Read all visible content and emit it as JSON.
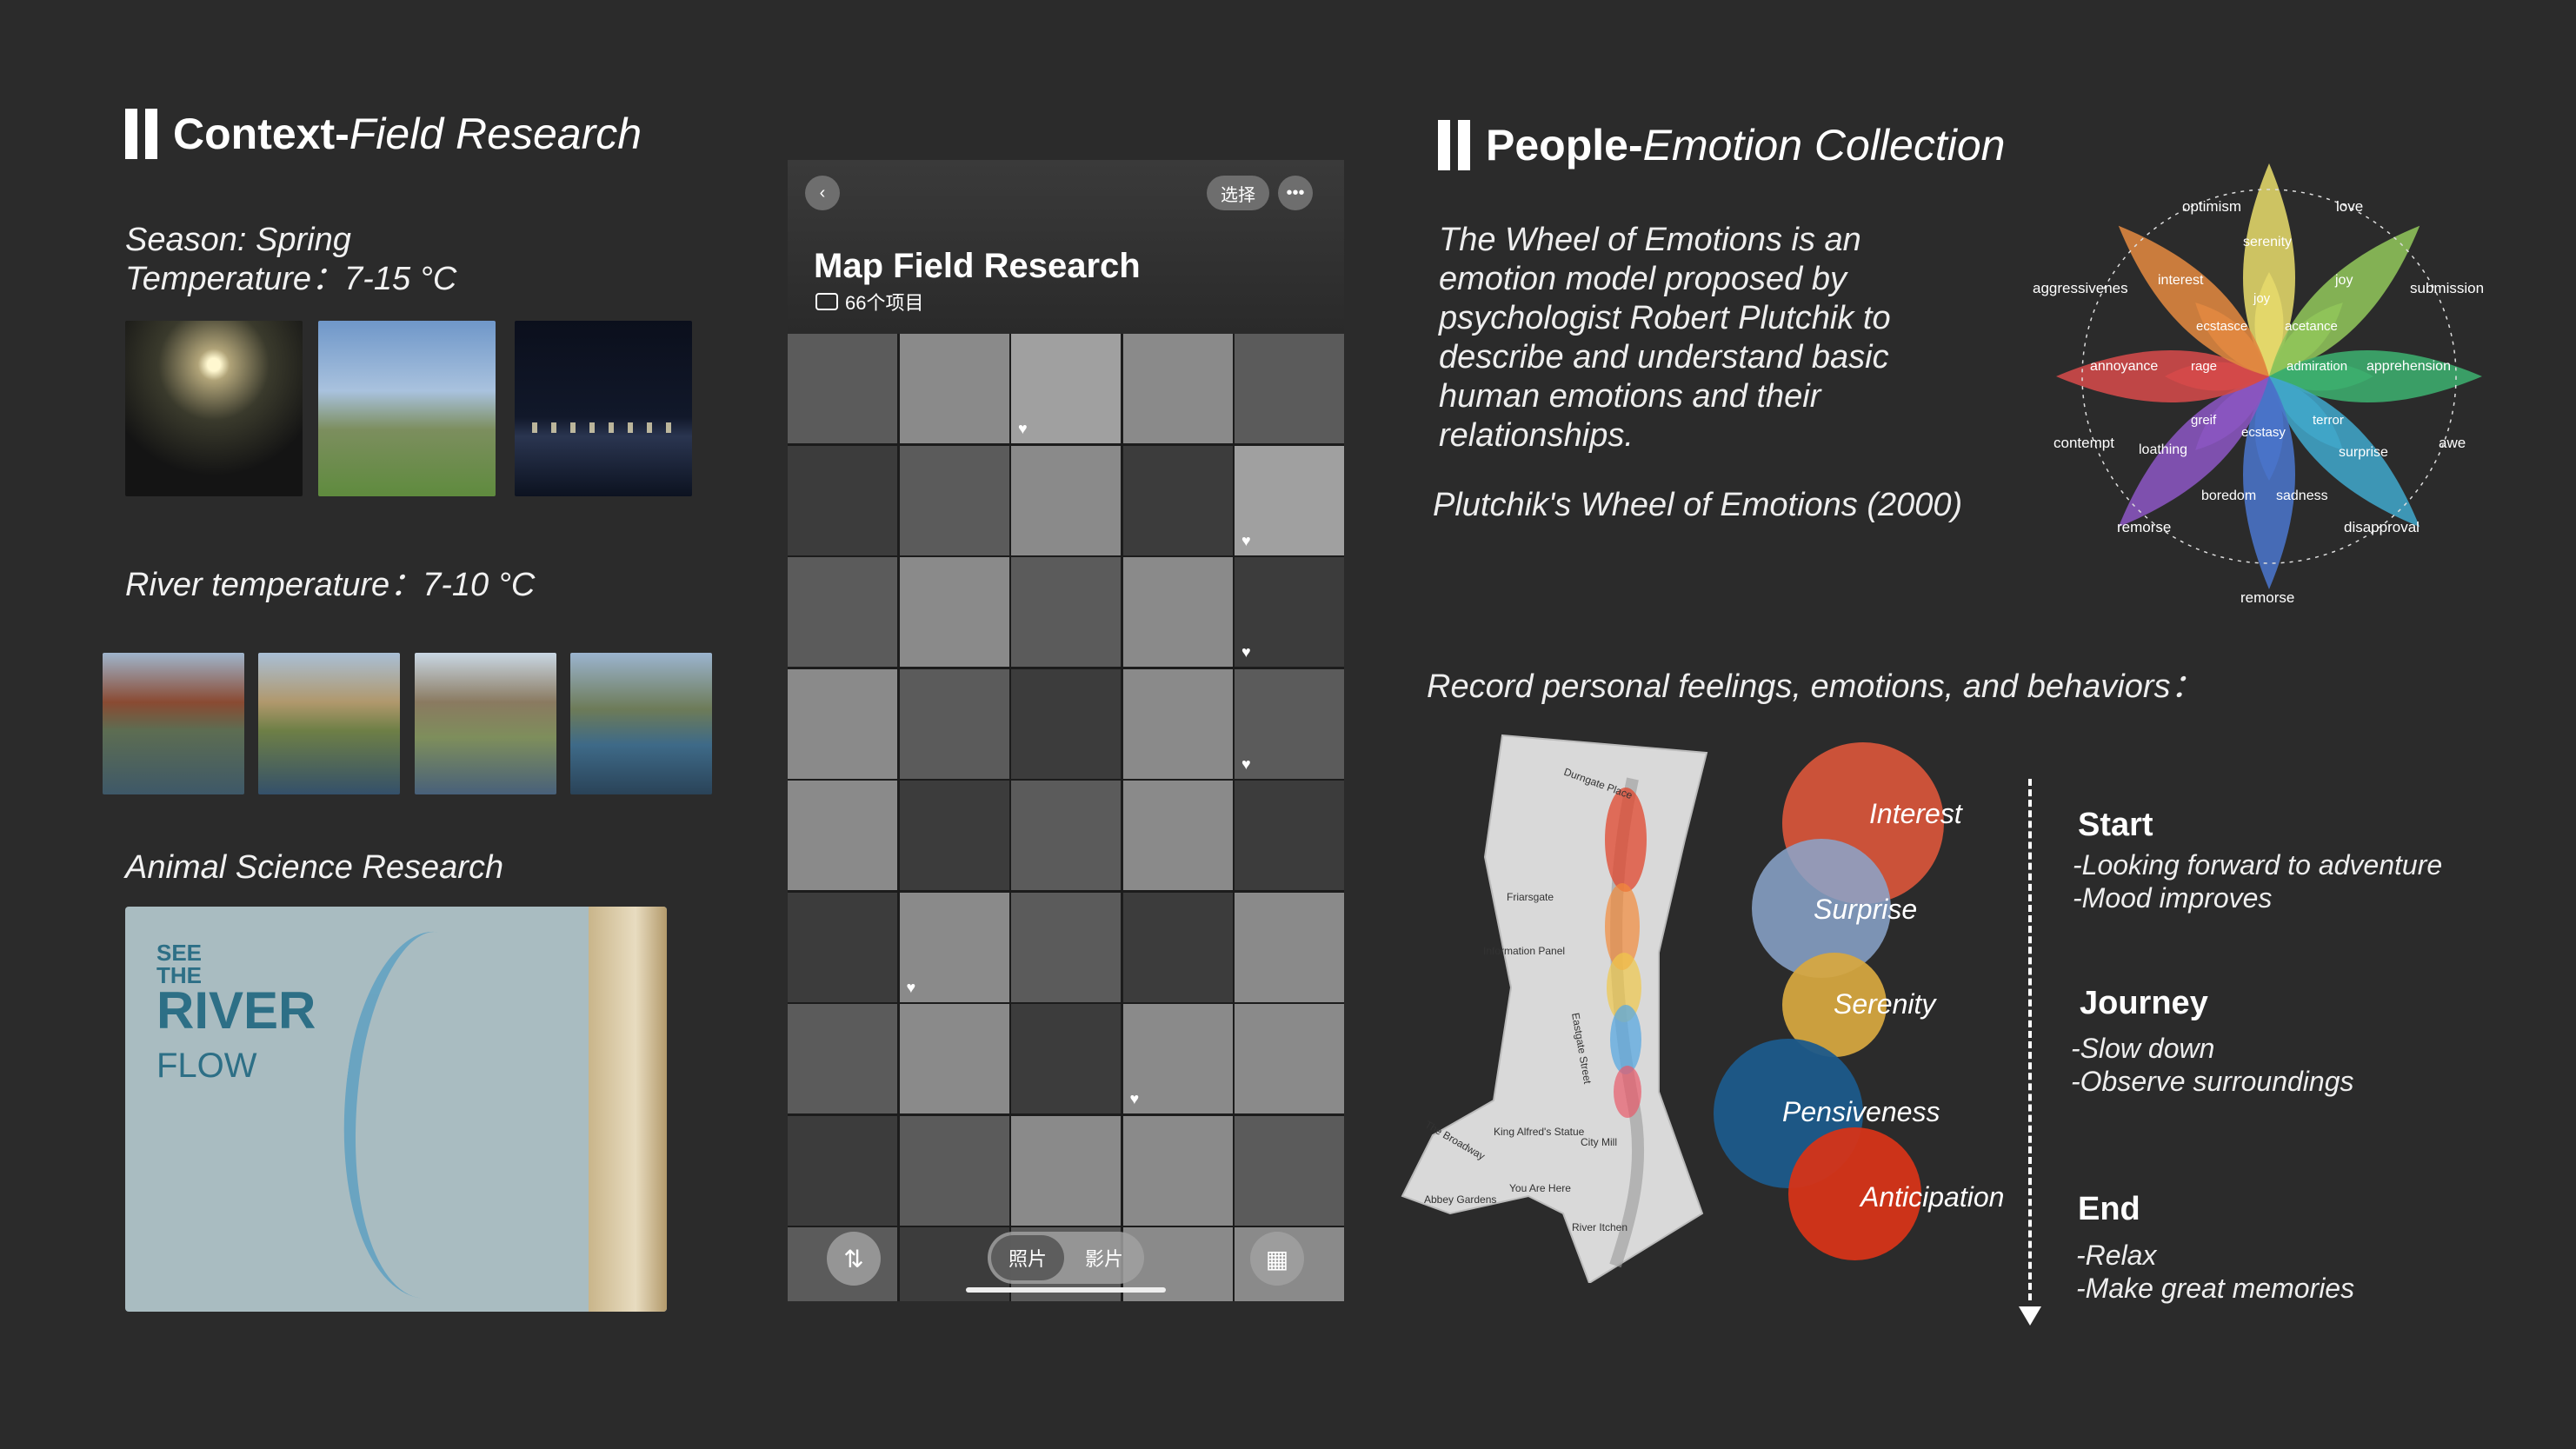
{
  "left": {
    "title_bold": "Context-",
    "title_italic": "Field Research",
    "season": "Season: Spring",
    "temperature": "Temperature：7-15 °C",
    "river_temperature": "River temperature：7-10 °C",
    "animal": "Animal Science Research",
    "board": {
      "see": "SEE",
      "the": "THE",
      "river": "RIVER",
      "flow": "FLOW"
    }
  },
  "phone": {
    "title": "Map Field Research",
    "count": "66个项目",
    "select_button": "选择",
    "more_icon": "more-icon",
    "back_icon": "chevron-left-icon",
    "sort_icon": "sort-icon",
    "grid_icon": "grid-icon",
    "tabs": [
      "照片",
      "影片"
    ]
  },
  "right": {
    "title_bold": "People-",
    "title_italic": "Emotion Collection",
    "description": [
      "The Wheel of Emotions is an",
      "emotion model proposed by",
      "psychologist Robert Plutchik to",
      "describe and understand basic",
      "human emotions and their",
      "relationships."
    ],
    "citation": "Plutchik's Wheel of Emotions (2000)",
    "record": "Record personal feelings, emotions, and behaviors："
  },
  "wheel": {
    "outer_labels": [
      "optimism",
      "love",
      "submission",
      "awe",
      "disapproval",
      "remorse",
      "remorse",
      "contempt",
      "aggressivenes"
    ],
    "petal_outer": [
      "serenity",
      "joy",
      "apprehension",
      "surprise",
      "sadness",
      "boredom",
      "annoyance",
      "interest"
    ],
    "petal_inner": [
      "joy",
      "acetance",
      "admiration",
      "terror",
      "ecstasy",
      "greif",
      "rage",
      "ecstasce",
      "loathing"
    ],
    "colors": [
      "#e4d86a",
      "#8fc45a",
      "#3cae6e",
      "#40a5c8",
      "#4a74c9",
      "#8a55c0",
      "#d44a4a",
      "#e08840",
      "#d7a052"
    ]
  },
  "emotions": [
    {
      "label": "Interest",
      "color": "#d7553a"
    },
    {
      "label": "Surprise",
      "color": "#8ba6cc"
    },
    {
      "label": "Serenity",
      "color": "#d7a83f"
    },
    {
      "label": "Pensiveness",
      "color": "#1c5a8a"
    },
    {
      "label": "Anticipation",
      "color": "#d53418"
    }
  ],
  "stages": [
    {
      "title": "Start",
      "lines": [
        "-Looking forward to adventure",
        "-Mood improves"
      ]
    },
    {
      "title": "Journey",
      "lines": [
        "-Slow down",
        "-Observe surroundings"
      ]
    },
    {
      "title": "End",
      "lines": [
        "-Relax",
        "-Make great memories"
      ]
    }
  ],
  "map_labels": [
    "Durngate Place",
    "Friarsgate",
    "Information Panel",
    "Eastgate Street",
    "King Alfred's Statue",
    "City Mill",
    "You Are Here",
    "Abbey Gardens",
    "River Itchen",
    "The Broadway"
  ]
}
